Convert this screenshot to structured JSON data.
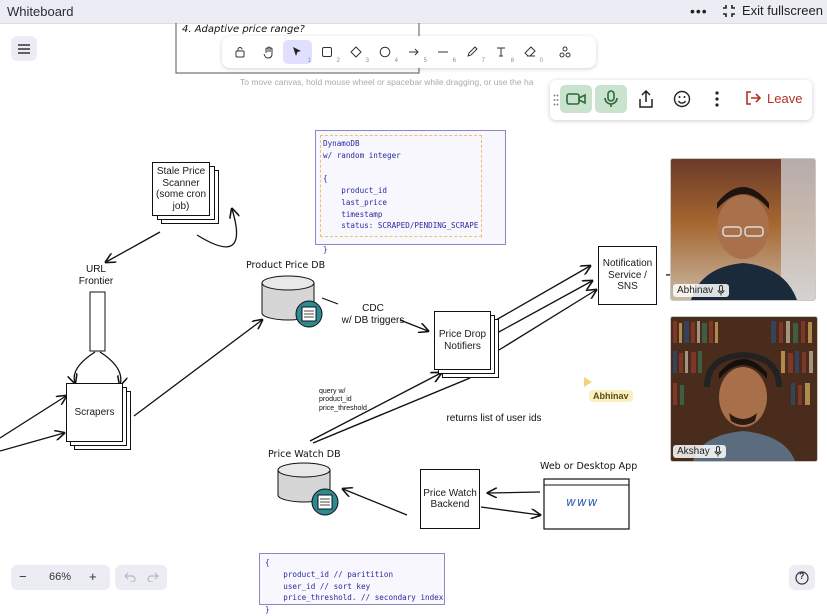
{
  "topbar": {
    "title": "Whiteboard",
    "more": "•••",
    "exit_label": "Exit fullscreen"
  },
  "toolbar": {
    "tools": [
      {
        "name": "lock",
        "num": ""
      },
      {
        "name": "hand",
        "num": ""
      },
      {
        "name": "select",
        "num": "1"
      },
      {
        "name": "rectangle",
        "num": "2"
      },
      {
        "name": "diamond",
        "num": "3"
      },
      {
        "name": "ellipse",
        "num": "4"
      },
      {
        "name": "arrow",
        "num": "5"
      },
      {
        "name": "line",
        "num": "6"
      },
      {
        "name": "draw",
        "num": "7"
      },
      {
        "name": "text",
        "num": "8"
      },
      {
        "name": "eraser",
        "num": "0"
      },
      {
        "name": "shapes",
        "num": ""
      }
    ],
    "hint": "To move canvas, hold mouse wheel or spacebar while dragging, or use the ha"
  },
  "call": {
    "leave_label": "Leave",
    "participants": [
      {
        "name": "Abhinav"
      },
      {
        "name": "Akshay"
      }
    ]
  },
  "cursor_label": "Abhinav",
  "canvas": {
    "top_note": "4. Adaptive price range?",
    "stale_scanner": "Stale Price Scanner (some cron job)",
    "url_frontier": "URL\nFrontier",
    "scrapers": "Scrapers",
    "product_price_db": "Product Price DB",
    "cdc": "CDC\nw/ DB triggers",
    "price_drop_notifiers": "Price Drop Notifiers",
    "notification_service": "Notification Service / SNS",
    "query_note": "query w/\nproduct_id\nprice_threshold",
    "returns_note": "returns list of user ids",
    "price_watch_db": "Price Watch DB",
    "price_watch_backend": "Price Watch Backend",
    "web_app": "Web or Desktop App",
    "www": "www",
    "dynamo_code": "DynamoDB\nw/ random integer\n\n{\n    product_id\n    last_price\n    timestamp\n    status: SCRAPED/PENDING_SCRAPE\n\n}",
    "watch_code": "{\n    product_id // paritition\n    user_id // sort key\n    price_threshold. // secondary index\n}"
  },
  "zoom": {
    "minus": "−",
    "value": "66%",
    "plus": "+"
  },
  "help": "?"
}
